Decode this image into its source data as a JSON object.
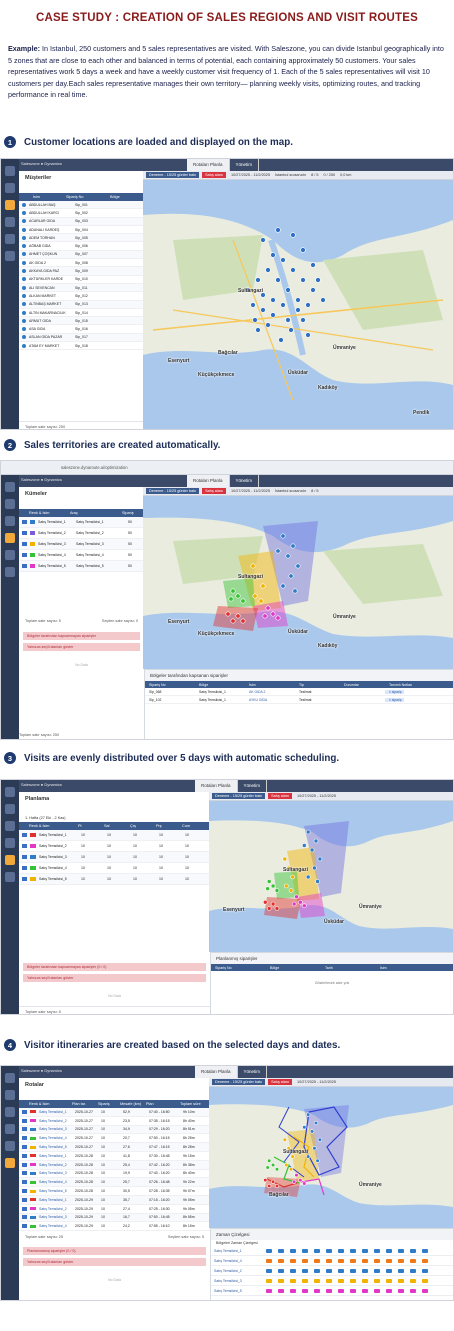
{
  "title": "CASE STUDY : CREATION OF SALES REGIONS AND VISIT ROUTES",
  "example": {
    "label": "Example:",
    "text": " In Istanbul, 250 customers and 5 sales representatives are visited. With Saleszone, you can divide Istanbul geographically into 5 zones that are close to each other and balanced in terms of potential, each containing approximately 50 customers. Your sales representatives work 5 days a week and have a weekly customer visit frequency of 1. Each of the 5 sales representatives will visit 10 customers per day.Each sales representative manages their own territory— planning weekly visits, optimizing routes, and tracking performance in real time."
  },
  "steps": [
    {
      "num": "1",
      "text": "Customer locations are loaded and displayed on the map."
    },
    {
      "num": "2",
      "text": "Sales territories are created automatically."
    },
    {
      "num": "3",
      "text": "Visits are evenly distributed over 5 days with automatic scheduling."
    },
    {
      "num": "4",
      "text": "Visitor itineraries are created based on the selected days and dates."
    }
  ],
  "app": {
    "brand": "Saleszone ● Dynamics",
    "tab_plan": "Rotaları Planla",
    "tab_manage": "Yönetim",
    "map_chip": "Deneme - 15/25 günler bakı",
    "map_chip2": "Satış alanı",
    "map_info": [
      "10/27/2025 - 11/2/2025",
      "İstanbul sıcaanıdır",
      "8 / 5",
      "0 / 250",
      "0,0 km",
      "0h 0m",
      "0,0 ₺",
      "CO₂ 0 kg"
    ],
    "map_labels": [
      "Sultangazi",
      "Esenyurt",
      "Bağcılar",
      "Küçükçekmece",
      "Üsküdar",
      "Ümraniye",
      "Kadıköy",
      "Pendik"
    ]
  },
  "shot1": {
    "panel_title": "Müşteriler",
    "headers": [
      "İsim",
      "Sipariş No",
      "Bölge"
    ],
    "rows": [
      [
        "ABDULLAH BAŞ",
        "Sip_001"
      ],
      [
        "ABDULLAH KARCI",
        "Sip_002"
      ],
      [
        "ACARLAR GIDA",
        "Sip_003"
      ],
      [
        "ADANALI KARDEŞ",
        "Sip_004"
      ],
      [
        "ADEM TORHAN",
        "Sip_005"
      ],
      [
        "AĞBAB GIDA",
        "Sip_006"
      ],
      [
        "AHMET ÇOŞKUN",
        "Sip_007"
      ],
      [
        "AK GIDA  2",
        "Sip_008"
      ],
      [
        "AKKAYA GIDA PAZ",
        "Sip_009"
      ],
      [
        "AKTÜRKLER KARDE",
        "Sip_010"
      ],
      [
        "ALİ SEVENCAN",
        "Sip_011"
      ],
      [
        "ALKAN MARKET",
        "Sip_012"
      ],
      [
        "ALTINBAŞ MARKET",
        "Sip_013"
      ],
      [
        "ALTIN MAKARNACILIK",
        "Sip_014"
      ],
      [
        "ARMUT GIDA",
        "Sip_015"
      ],
      [
        "ASA GIDA",
        "Sip_016"
      ],
      [
        "ASLAN GIDA PAZAR",
        "Sip_017"
      ],
      [
        "ATAM EY MARKET",
        "Sip_018"
      ]
    ],
    "footer": "Toplam satır sayısı: 250"
  },
  "shot2": {
    "url": "saleszone.dynaroute.ai/optimization",
    "panel_title": "Kümeler",
    "headers": [
      "Renk & İsim",
      "Araç",
      "Sipariş"
    ],
    "rows": [
      [
        "Satış Temsilcisi_1",
        "Satış Temsilcisi_1",
        "50"
      ],
      [
        "Satış Temsilcisi_2",
        "Satış Temsilcisi_2",
        "50"
      ],
      [
        "Satış Temsilcisi_3",
        "Satış Temsilcisi_3",
        "50"
      ],
      [
        "Satış Temsilcisi_4",
        "Satış Temsilcisi_4",
        "50"
      ],
      [
        "Satış Temsilcisi_5",
        "Satış Temsilcisi_5",
        "50"
      ]
    ],
    "footer_left": "Toplam satır sayısı: 5",
    "footer_right": "Seçilen satır sayısı: 0",
    "pink1": "Bölgeler tarafından kapsanmayan siparişler",
    "pink2": "Yalnızca seçili alanları göster",
    "no_data": "No Data",
    "bottom_title": "Bölgeler tarafından kapsanan siparişler",
    "bottom_headers": [
      "Sipariş No",
      "Bölge",
      "İsim",
      "Tip",
      "Durumlar",
      "Tanımlı Notları"
    ],
    "bottom_rows": [
      [
        "Sip_068",
        "Satış Temsilcisi_1",
        "AK GIDA  2",
        "Teslimat",
        "",
        "1 sipariş"
      ],
      [
        "Sip_102",
        "Satış Temsilcisi_1",
        "AYKU GIDA",
        "Teslimat",
        "",
        "1 sipariş"
      ]
    ],
    "bottom_footer": "Toplam satır sayısı: 250"
  },
  "shot3": {
    "panel_title": "Planlama",
    "week": "1. Hafta (27 Eki - 2 Kas)",
    "headers": [
      "Renk & İsim",
      "Pt",
      "Sal",
      "Çrş",
      "Prş",
      "Cum"
    ],
    "rows": [
      [
        "Satış Temsilcisi_1",
        "10",
        "10",
        "10",
        "10",
        "10"
      ],
      [
        "Satış Temsilcisi_2",
        "10",
        "10",
        "10",
        "10",
        "10"
      ],
      [
        "Satış Temsilcisi_3",
        "10",
        "10",
        "10",
        "10",
        "10"
      ],
      [
        "Satış Temsilcisi_4",
        "10",
        "10",
        "10",
        "10",
        "10"
      ],
      [
        "Satış Temsilcisi_5",
        "10",
        "10",
        "10",
        "10",
        "10"
      ]
    ],
    "pink1": "Bölgeler tarafından kapsanmayan siparişler (0 / 0)",
    "pink2": "Yalnızca seçili alanları göster",
    "bottom_title": "Planlanmış siparişler",
    "bottom_headers": [
      "Sipariş No",
      "Bölge",
      "Tarih",
      "İsim"
    ],
    "bottom_empty": "Gösterilecek satır yok",
    "footer": "Toplam satır sayısı: 5"
  },
  "shot4": {
    "panel_title": "Rotalar",
    "headers": [
      "Renk & İsim",
      "Plan tar.",
      "Sipariş",
      "Mesafe (km)",
      "Plan",
      "Toplam süre"
    ],
    "rows": [
      [
        "Satış Temsilcisi_1",
        "2025-10-27",
        "10",
        "52,9",
        "07:40 - 16:50",
        "9h 10m"
      ],
      [
        "Satış Temsilcisi_2",
        "2025-10-27",
        "10",
        "23,5",
        "07:35 - 16:15",
        "8h 40m"
      ],
      [
        "Satış Temsilcisi_3",
        "2025-10-27",
        "10",
        "34,9",
        "07:29 - 16:20",
        "8h 51m"
      ],
      [
        "Satış Temsilcisi_4",
        "2025-10-27",
        "10",
        "20,7",
        "07:50 - 16:15",
        "8h 25m"
      ],
      [
        "Satış Temsilcisi_5",
        "2025-10-27",
        "10",
        "27,6",
        "07:47 - 16:15",
        "8h 28m"
      ],
      [
        "Satış Temsilcisi_1",
        "2025-10-28",
        "10",
        "41,8",
        "07:30 - 16:45",
        "9h 15m"
      ],
      [
        "Satış Temsilcisi_2",
        "2025-10-28",
        "10",
        "25,4",
        "07:42 - 16:20",
        "8h 38m"
      ],
      [
        "Satış Temsilcisi_3",
        "2025-10-28",
        "10",
        "19,9",
        "07:40 - 16:20",
        "8h 40m"
      ],
      [
        "Satış Temsilcisi_4",
        "2025-10-28",
        "10",
        "25,7",
        "07:26 - 16:48",
        "9h 22m"
      ],
      [
        "Satış Temsilcisi_5",
        "2025-10-28",
        "10",
        "30,5",
        "07:28 - 16:35",
        "9h 07m"
      ],
      [
        "Satış Temsilcisi_1",
        "2025-10-29",
        "10",
        "35,7",
        "07:15 - 16:20",
        "9h 05m"
      ],
      [
        "Satış Temsilcisi_2",
        "2025-10-29",
        "10",
        "27,4",
        "07:25 - 16:30",
        "9h 05m"
      ],
      [
        "Satış Temsilcisi_3",
        "2025-10-29",
        "10",
        "16,7",
        "07:50 - 16:45",
        "8h 55m"
      ],
      [
        "Satış Temsilcisi_4",
        "2025-10-29",
        "10",
        "24,2",
        "07:55 - 16:10",
        "8h 15m"
      ]
    ],
    "footer_left": "Toplam satır sayısı: 25",
    "footer_right": "Seçilen satır sayısı: 5",
    "pink1": "Planlanmamış siparişler (0 / 0)",
    "pink2": "Yalnızca seçili alanları göster",
    "gantt_tab": "Zaman Çizelgesi",
    "gantt_title": "Bölgeleri Zaman Çizelgesi",
    "gantt_rows": [
      "Satış Temsilcisi_1",
      "Satış Temsilcisi_4",
      "Satış Temsilcisi_2",
      "Satış Temsilcisi_3",
      "Satış Temsilcisi_5"
    ]
  },
  "colors": {
    "red": "#e0312f",
    "blue": "#2f7cc9",
    "purple": "#7a5ad8",
    "yellow": "#f2b300",
    "green": "#35c335",
    "magenta": "#e236c9",
    "orange": "#f07a1a"
  }
}
